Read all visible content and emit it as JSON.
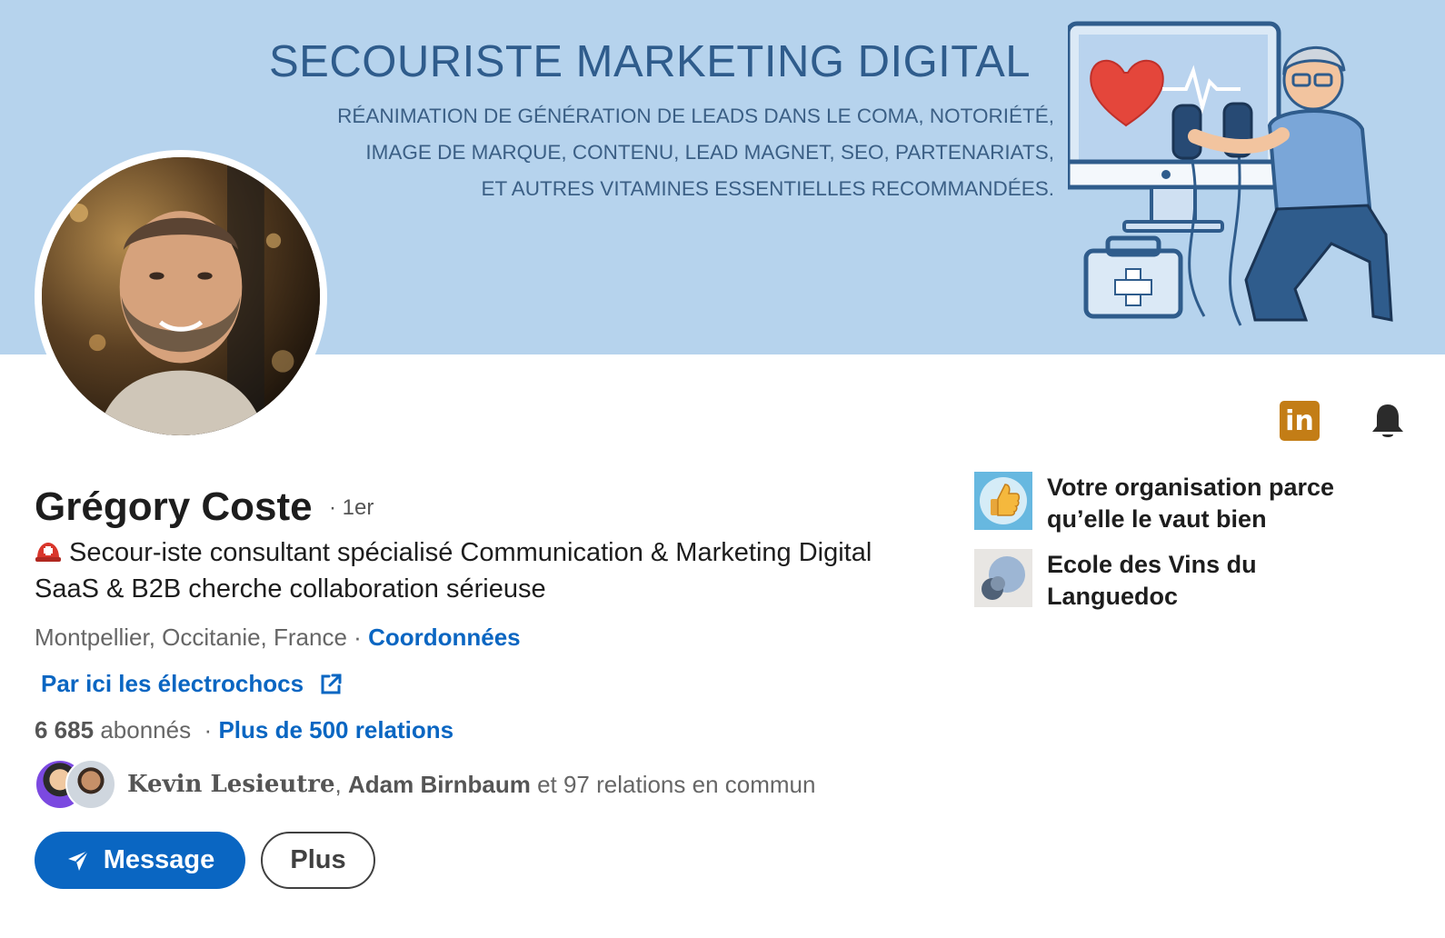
{
  "banner": {
    "title": "SECOURISTE MARKETING DIGITAL",
    "lines": [
      "RÉANIMATION DE GÉNÉRATION DE LEADS DANS LE COMA, NOTORIÉTÉ,",
      "IMAGE DE MARQUE, CONTENU, LEAD MAGNET, SEO, PARTENARIATS,",
      "ET AUTRES VITAMINES ESSENTIELLES RECOMMANDÉES."
    ]
  },
  "profile": {
    "name": "Grégory Coste",
    "degree": "· 1er",
    "headline": "Secour-iste consultant spécialisé Communication & Marketing Digital SaaS & B2B cherche collaboration sérieuse",
    "location": "Montpellier, Occitanie, France",
    "separator": "·",
    "contact_link": "Coordonnées",
    "website_link": "Par ici les électrochocs",
    "followers_count": "6 685",
    "followers_label": "abonnés",
    "relations_sep": "·",
    "relations_link": "Plus de 500 relations",
    "mutual": {
      "first": "Kevin Lesieutre",
      "comma": ",",
      "second": "Adam Birnbaum",
      "rest": "et 97 relations en commun"
    }
  },
  "actions": {
    "message_label": "Message",
    "more_label": "Plus"
  },
  "top_icons": {
    "linkedin_label": "in"
  },
  "organizations": [
    {
      "name": "Votre organisation parce qu’elle le vaut bien"
    },
    {
      "name": "Ecole des Vins du Languedoc"
    }
  ],
  "colors": {
    "banner_bg": "#b6d3ed",
    "brand_blue": "#0a66c2",
    "linkedin_orange": "#c37d16"
  }
}
